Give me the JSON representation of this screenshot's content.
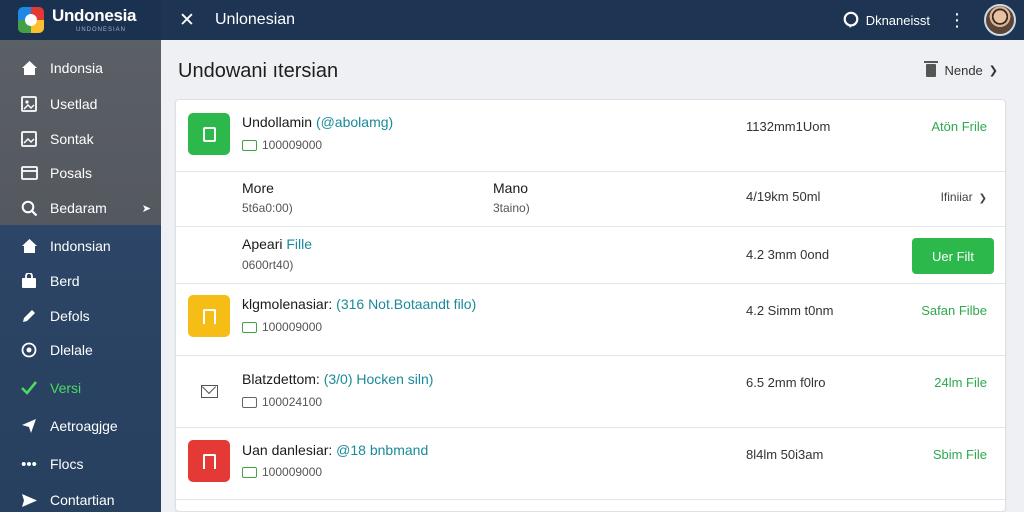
{
  "app": {
    "brand_name": "Undonesia",
    "brand_sub": "UNDONESIAN",
    "window_title": "Unlonesian",
    "user_name": "Dknaneisst"
  },
  "sidebar": {
    "items": [
      {
        "label": "Indonsia",
        "icon": "home-icon"
      },
      {
        "label": "Usetlad",
        "icon": "image-icon"
      },
      {
        "label": "Sontak",
        "icon": "image-icon"
      },
      {
        "label": "Posals",
        "icon": "card-icon"
      },
      {
        "label": "Bedaram",
        "icon": "search-icon"
      },
      {
        "label": "Indonsian",
        "icon": "home-icon"
      },
      {
        "label": "Berd",
        "icon": "bag-icon"
      },
      {
        "label": "Defols",
        "icon": "pencil-icon"
      },
      {
        "label": "Dlelale",
        "icon": "target-icon"
      },
      {
        "label": "Versi",
        "icon": "check-icon"
      },
      {
        "label": "Aetroagjge",
        "icon": "plane-icon"
      },
      {
        "label": "Flocs",
        "icon": "dots-icon"
      },
      {
        "label": "Contartian",
        "icon": "send-icon"
      }
    ],
    "active_index": 9
  },
  "main": {
    "title": "Undowani ıtersian",
    "sort_label": "Nende"
  },
  "rows": [
    {
      "kind": "file",
      "icon_color": "#2db84c",
      "title": "Undollamin",
      "title_accent": "(@abolamg)",
      "sub": "100009000",
      "size": "1132mm1Uom",
      "action": "Atön Frile"
    },
    {
      "kind": "columns",
      "col1_label": "More",
      "col1_value": "5t6a0:00)",
      "col2_label": "Mano",
      "col2_value": "3taino)",
      "size": "4/19km 50ml",
      "action": "Ifiniiar"
    },
    {
      "kind": "button",
      "title": "Apeari",
      "title_accent": "Fille",
      "sub": "0600rt40)",
      "size": "4.2 3mm 0ond",
      "button_label": "Uer Filt"
    },
    {
      "kind": "file",
      "icon_color": "#f6bd16",
      "title": "klgmolenasiar:",
      "title_accent": "(316 Not.Botaandt filo)",
      "sub": "100009000",
      "size": "4.2 Simm t0nm",
      "action": "Safan Filbe"
    },
    {
      "kind": "mail",
      "title": "Blatzdettom:",
      "title_accent": "(3/0) Hocken siln)",
      "sub": "100024100",
      "size": "6.5 2mm f0lro",
      "action": "24lm File"
    },
    {
      "kind": "file",
      "icon_color": "#e53935",
      "title": "Uan danlesiar:",
      "title_accent": "@18 bnbmand",
      "sub": "100009000",
      "size": "8l4lm 50i3am",
      "action": "Sbim File"
    }
  ]
}
